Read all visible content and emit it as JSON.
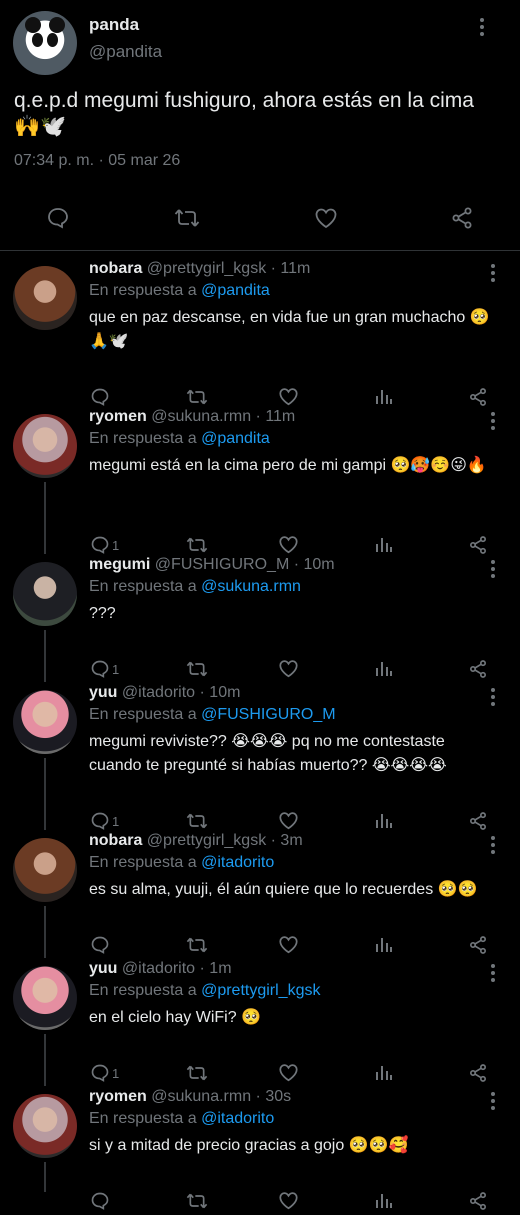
{
  "main_tweet": {
    "name": "panda",
    "handle": "@pandita",
    "text": "q.e.p.d megumi fushiguro, ahora estás en la cima",
    "emojis": "🙌🕊️",
    "timestamp": "07:34 p. m. · 05 mar 26"
  },
  "replies": [
    {
      "name": "nobara",
      "handle": "@prettygirl_kgsk",
      "time": "· 11m",
      "reply_prefix": "En respuesta a",
      "reply_to": "@pandita",
      "body": "que en paz descanse, en vida fue un gran muchacho",
      "emojis": "🥺🙏🕊️",
      "reply_count": ""
    },
    {
      "name": "ryomen",
      "handle": "@sukuna.rmn",
      "time": "· 11m",
      "reply_prefix": "En respuesta a",
      "reply_to": "@pandita",
      "body": "megumi está en la cima pero de mi gampi",
      "emojis": "🥺🥵☺️😜🔥",
      "reply_count": "1"
    },
    {
      "name": "megumi",
      "handle": "@FUSHIGURO_M",
      "time": "· 10m",
      "reply_prefix": "En respuesta a",
      "reply_to": "@sukuna.rmn",
      "body": "???",
      "emojis": "",
      "reply_count": "1"
    },
    {
      "name": "yuu",
      "handle": "@itadorito",
      "time": "· 10m",
      "reply_prefix": "En respuesta a",
      "reply_to": "@FUSHIGURO_M",
      "body": "megumi reviviste?? 😭😭😭 pq no me contestaste cuando te pregunté si habías muerto?? 😭😭😭😭",
      "emojis": "",
      "reply_count": "1"
    },
    {
      "name": "nobara",
      "handle": "@prettygirl_kgsk",
      "time": "· 3m",
      "reply_prefix": "En respuesta a",
      "reply_to": "@itadorito",
      "body": "es su alma, yuuji, él aún quiere que lo recuerdes",
      "emojis": "🥺🥺",
      "reply_count": ""
    },
    {
      "name": "yuu",
      "handle": "@itadorito",
      "time": "· 1m",
      "reply_prefix": "En respuesta a",
      "reply_to": "@prettygirl_kgsk",
      "body": "en el cielo hay WiFi?",
      "emojis": "🥺",
      "reply_count": "1"
    },
    {
      "name": "ryomen",
      "handle": "@sukuna.rmn",
      "time": "· 30s",
      "reply_prefix": "En respuesta a",
      "reply_to": "@itadorito",
      "body": "si y a mitad de precio gracias a gojo",
      "emojis": "🥺🥺🥰",
      "reply_count": ""
    }
  ],
  "colors": {
    "background": "#000000",
    "text": "#e7e9ea",
    "muted": "#71767b",
    "link": "#1d9bf0",
    "divider": "#2f3336"
  },
  "icons": [
    "comment-icon",
    "retweet-icon",
    "like-icon",
    "share-icon",
    "views-icon",
    "more-icon"
  ]
}
